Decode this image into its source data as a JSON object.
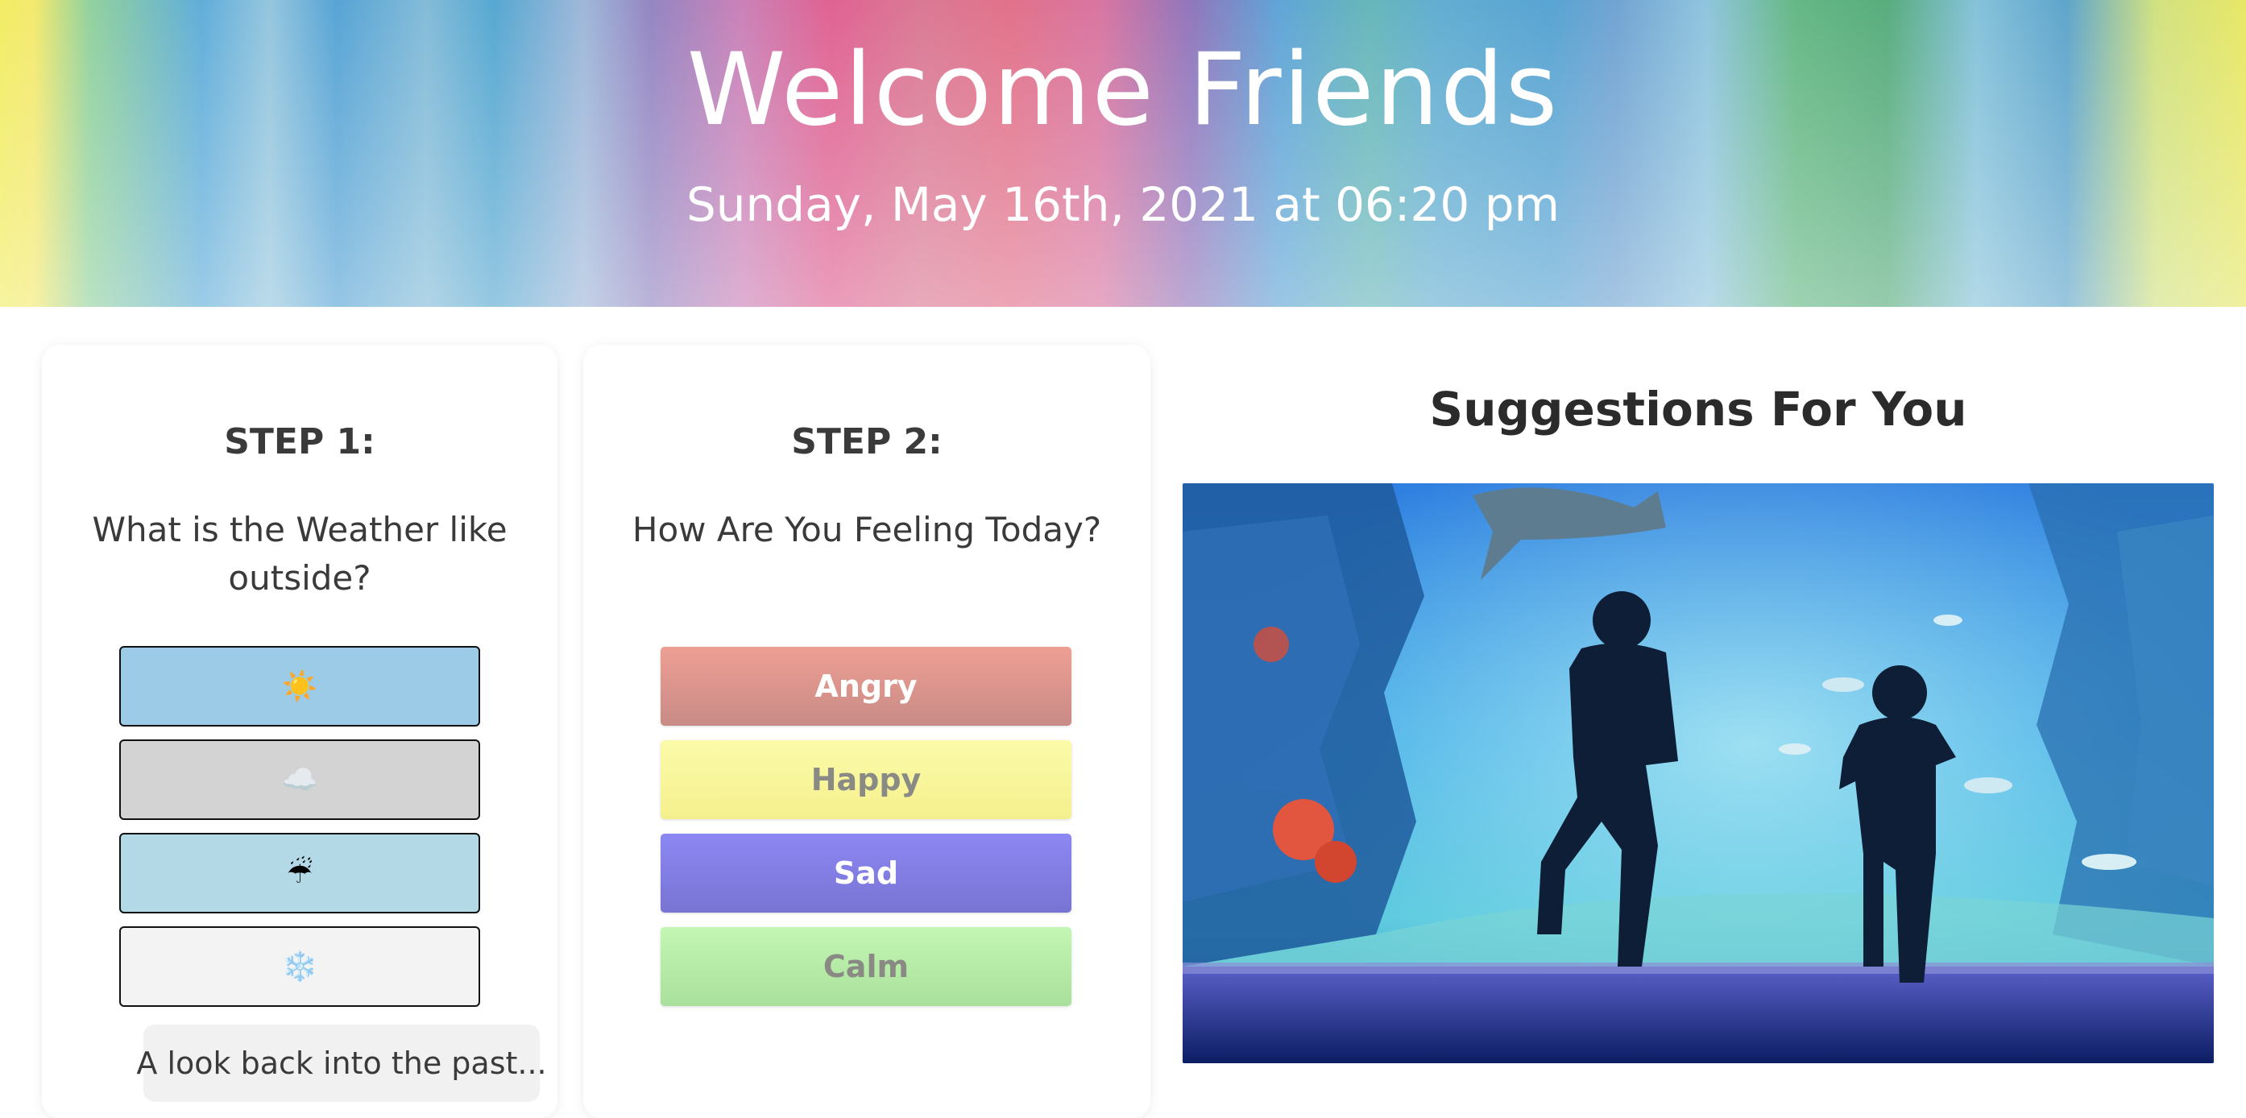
{
  "header": {
    "title": "Welcome Friends",
    "datetime": "Sunday, May 16th, 2021 at 06:20 pm"
  },
  "step1": {
    "title": "STEP 1:",
    "question": "What is the Weather like outside?",
    "options": [
      {
        "icon": "sun-icon",
        "glyph": "☀️",
        "color": "#9ccbe8"
      },
      {
        "icon": "cloud-icon",
        "glyph": "☁️",
        "color": "#d3d3d3"
      },
      {
        "icon": "umbrella-rain-icon",
        "glyph": "☔",
        "color": "#b3d8e6"
      },
      {
        "icon": "snowflake-icon",
        "glyph": "❄️",
        "color": "#f3f3f3"
      }
    ],
    "history_label": "A look back into the past..."
  },
  "step2": {
    "title": "STEP 2:",
    "question": "How Are You Feeling Today?",
    "moods": [
      {
        "label": "Angry",
        "color": "#e0958d"
      },
      {
        "label": "Happy",
        "color": "#f8f59c"
      },
      {
        "label": "Sad",
        "color": "#837df0"
      },
      {
        "label": "Calm",
        "color": "#b6ecaa"
      }
    ]
  },
  "suggestions": {
    "title": "Suggestions For You",
    "image": "aquarium-children-photo"
  }
}
